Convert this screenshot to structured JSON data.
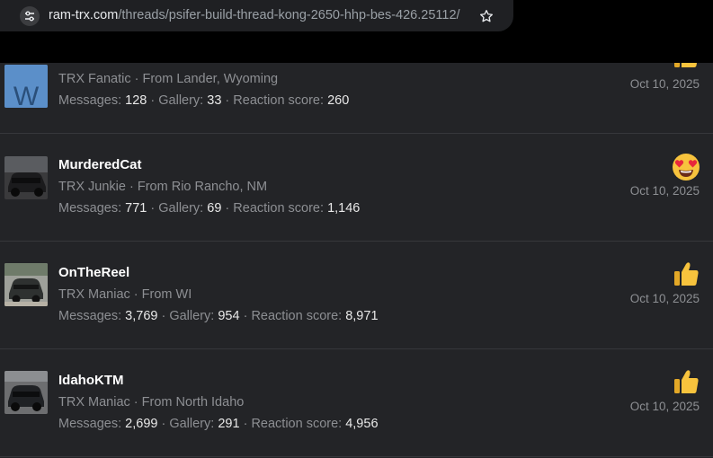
{
  "browser": {
    "url_host": "ram-trx.com",
    "url_path": "/threads/psifer-build-thread-kong-2650-hhp-bes-426.25112/"
  },
  "posts": [
    {
      "username": "",
      "title": "TRX Fanatic",
      "location_prefix": "From",
      "location": "Lander, Wyoming",
      "stats": {
        "messages_label": "Messages:",
        "messages": "128",
        "gallery_label": "Gallery:",
        "gallery": "33",
        "reaction_label": "Reaction score:",
        "reaction": "260"
      },
      "date": "Oct 10, 2025",
      "reaction_icon": "thumbs-up-icon"
    },
    {
      "username": "MurderedCat",
      "title": "TRX Junkie",
      "location_prefix": "From",
      "location": "Rio Rancho, NM",
      "stats": {
        "messages_label": "Messages:",
        "messages": "771",
        "gallery_label": "Gallery:",
        "gallery": "69",
        "reaction_label": "Reaction score:",
        "reaction": "1,146"
      },
      "date": "Oct 10, 2025",
      "reaction_icon": "heart-eyes-icon"
    },
    {
      "username": "OnTheReel",
      "title": "TRX Maniac",
      "location_prefix": "From",
      "location": "WI",
      "stats": {
        "messages_label": "Messages:",
        "messages": "3,769",
        "gallery_label": "Gallery:",
        "gallery": "954",
        "reaction_label": "Reaction score:",
        "reaction": "8,971"
      },
      "date": "Oct 10, 2025",
      "reaction_icon": "thumbs-up-icon"
    },
    {
      "username": "IdahoKTM",
      "title": "TRX Maniac",
      "location_prefix": "From",
      "location": "North Idaho",
      "stats": {
        "messages_label": "Messages:",
        "messages": "2,699",
        "gallery_label": "Gallery:",
        "gallery": "291",
        "reaction_label": "Reaction score:",
        "reaction": "4,956"
      },
      "date": "Oct 10, 2025",
      "reaction_icon": "thumbs-up-icon"
    }
  ],
  "colors": {
    "background": "#232427",
    "username": "#ffffff",
    "muted": "#8d8f93",
    "value": "#e9e9e9",
    "reaction": "#f7c33d"
  }
}
